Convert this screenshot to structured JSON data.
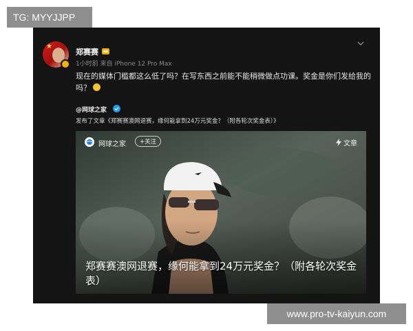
{
  "watermarks": {
    "top": "TG: MYYJJPP",
    "bottom": "www.pro-tv-kaiyun.com"
  },
  "post": {
    "username": "郑赛赛",
    "meta": "1小时前  来自 iPhone 12 Pro Max",
    "text": "现在的媒体门槛都这么低了吗？在写东西之前能不能稍微做点功课。奖金是你们发给我的吗？",
    "repost": {
      "author": "@网球之家",
      "description": "发布了文章《郑赛赛澳网退赛，缘何能拿到24万元奖金？（附各轮次奖金表）》"
    },
    "card": {
      "source": "网球之家",
      "follow_label": "+关注",
      "tag_label": "文章",
      "title": "郑赛赛澳网退赛，缘何能拿到24万元奖金？（附各轮次奖金表）"
    }
  },
  "icons": {
    "crown": "crown-icon",
    "chevron": "chevron-down-icon",
    "verified": "verified-icon",
    "emoji": "angry-emoji-icon",
    "lightning": "lightning-icon",
    "logo": "tennis-home-logo-icon"
  },
  "colors": {
    "background": "#141414",
    "text": "#e6e6e6",
    "meta": "#8a8a8a",
    "verified": "#1f9bf0",
    "badge": "#f2b20c",
    "watermark": "#8f8f8f"
  }
}
